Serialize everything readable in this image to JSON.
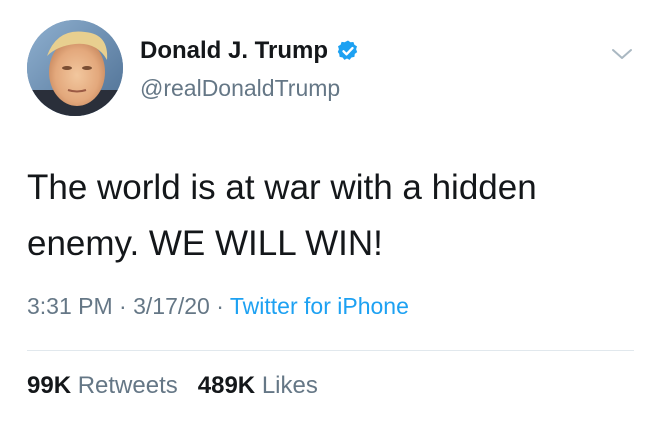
{
  "tweet": {
    "author": {
      "display_name": "Donald J. Trump",
      "handle": "@realDonaldTrump",
      "verified": true,
      "avatar_icon": "profile-photo",
      "verified_icon": "verified-badge-icon"
    },
    "text_line_1": "The world is at war with a hidden",
    "text_line_2": "enemy. WE WILL WIN!",
    "time": "3:31 PM",
    "separator": "·",
    "date": "3/17/20",
    "source": "Twitter for iPhone",
    "stats": {
      "retweets_count": "99K",
      "retweets_label": "Retweets",
      "likes_count": "489K",
      "likes_label": "Likes"
    }
  },
  "colors": {
    "text_primary": "#14171a",
    "text_secondary": "#657786",
    "accent": "#1da1f2",
    "divider": "#e1e8ed"
  },
  "icons": {
    "menu": "chevron-down-icon"
  }
}
